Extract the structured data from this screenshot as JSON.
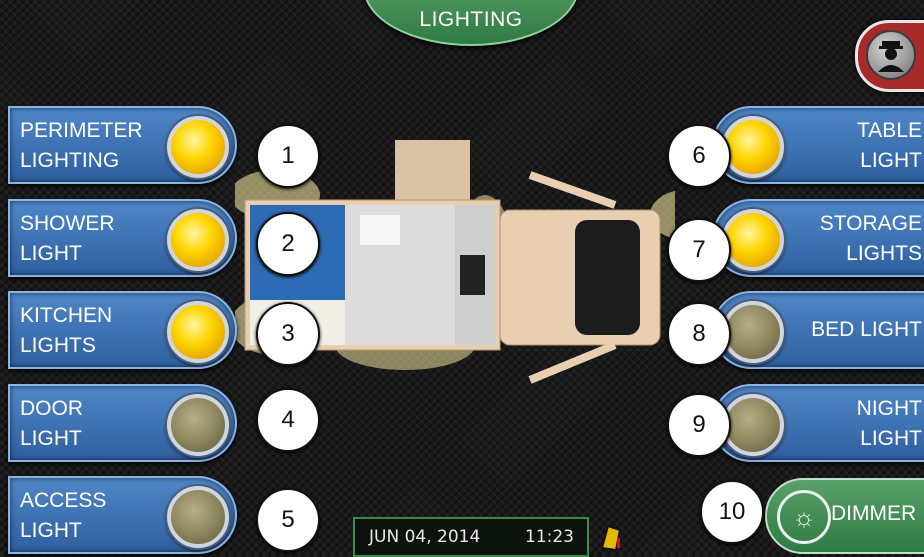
{
  "header": {
    "title": "LIGHTING"
  },
  "home": {
    "icon": "person-silhouette-icon"
  },
  "left_buttons": [
    {
      "label": "PERIMETER\nLIGHTING",
      "state": "on",
      "number": "1"
    },
    {
      "label": "SHOWER\nLIGHT",
      "state": "on",
      "number": "2"
    },
    {
      "label": "KITCHEN\nLIGHTS",
      "state": "on",
      "number": "3"
    },
    {
      "label": "DOOR\nLIGHT",
      "state": "off",
      "number": "4"
    },
    {
      "label": "ACCESS\nLIGHT",
      "state": "off",
      "number": "5"
    }
  ],
  "right_buttons": [
    {
      "label": "TABLE\nLIGHT",
      "state": "on",
      "number": "6"
    },
    {
      "label": "STORAGE\nLIGHTS",
      "state": "on",
      "number": "7"
    },
    {
      "label": "BED LIGHT",
      "state": "off",
      "number": "8"
    },
    {
      "label": "NIGHT\nLIGHT",
      "state": "off",
      "number": "9"
    }
  ],
  "dimmer": {
    "label": "DIMMER",
    "number": "10",
    "icon": "lightbulb-icon"
  },
  "status_bar": {
    "date": "JUN 04, 2014",
    "time": "11:23",
    "icon": "warning-icon"
  },
  "colors": {
    "on_lamp": "#ffd400",
    "off_lamp": "#8a835b",
    "button_blue": "#3a6fb0",
    "accent_green": "#3a8a50",
    "home_red": "#a92a2a"
  }
}
